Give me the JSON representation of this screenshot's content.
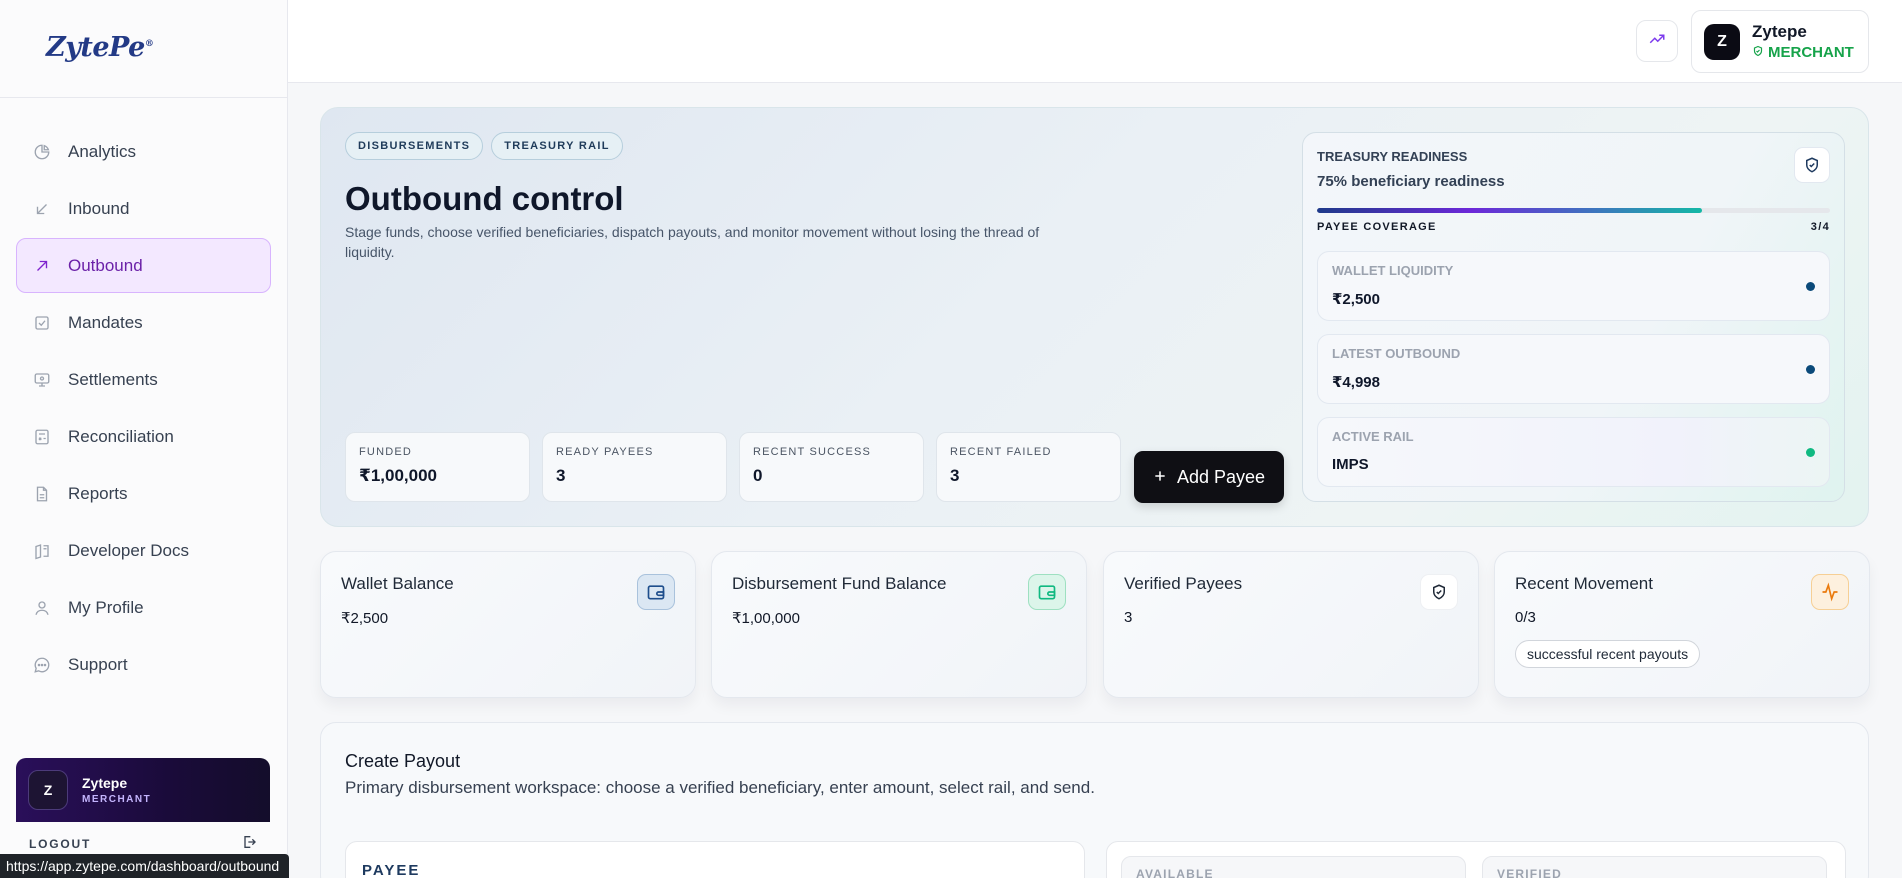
{
  "brand": {
    "logo_text": "ZytePe",
    "logo_mark": "®"
  },
  "sidebar": {
    "items": [
      {
        "label": "Analytics",
        "icon": "pie-chart-icon"
      },
      {
        "label": "Inbound",
        "icon": "arrow-down-left-icon"
      },
      {
        "label": "Outbound",
        "icon": "arrow-up-right-icon",
        "active": true
      },
      {
        "label": "Mandates",
        "icon": "checklist-icon"
      },
      {
        "label": "Settlements",
        "icon": "monitor-icon"
      },
      {
        "label": "Reconciliation",
        "icon": "calculator-icon"
      },
      {
        "label": "Reports",
        "icon": "file-icon"
      },
      {
        "label": "Developer Docs",
        "icon": "book-icon"
      },
      {
        "label": "My Profile",
        "icon": "user-icon"
      },
      {
        "label": "Support",
        "icon": "chat-icon"
      }
    ],
    "user": {
      "initial": "Z",
      "name": "Zytepe",
      "role": "MERCHANT"
    },
    "logout_label": "LOGOUT"
  },
  "status_url": "https://app.zytepe.com/dashboard/outbound",
  "topbar": {
    "account": {
      "initial": "Z",
      "name": "Zytepe",
      "role": "MERCHANT"
    }
  },
  "hero": {
    "tags": [
      "DISBURSEMENTS",
      "TREASURY RAIL"
    ],
    "title": "Outbound control",
    "subtitle": "Stage funds, choose verified beneficiaries, dispatch payouts, and monitor movement without losing the thread of liquidity.",
    "stats": [
      {
        "label": "FUNDED",
        "value": "₹1,00,000"
      },
      {
        "label": "READY PAYEES",
        "value": "3"
      },
      {
        "label": "RECENT SUCCESS",
        "value": "0"
      },
      {
        "label": "RECENT FAILED",
        "value": "3"
      }
    ],
    "add_payee_label": "Add Payee",
    "readiness": {
      "title": "TREASURY READINESS",
      "subtitle": "75% beneficiary readiness",
      "progress": 0.75,
      "coverage_label": "PAYEE COVERAGE",
      "coverage_value": "3/4",
      "cards": [
        {
          "label": "WALLET LIQUIDITY",
          "value": "₹2,500",
          "dot_color": "#0b4a7a"
        },
        {
          "label": "LATEST OUTBOUND",
          "value": "₹4,998",
          "dot_color": "#0b4a7a"
        },
        {
          "label": "ACTIVE RAIL",
          "value": "IMPS",
          "dot_color": "#10b981"
        }
      ]
    }
  },
  "summary": [
    {
      "title": "Wallet Balance",
      "value": "₹2,500",
      "icon": "wallet-icon"
    },
    {
      "title": "Disbursement Fund Balance",
      "value": "₹1,00,000",
      "icon": "wallet-green-icon"
    },
    {
      "title": "Verified Payees",
      "value": "3",
      "icon": "shield-check-icon"
    },
    {
      "title": "Recent Movement",
      "value": "0/3",
      "icon": "activity-icon",
      "pill": "successful recent payouts"
    }
  ],
  "payout": {
    "title": "Create Payout",
    "subtitle": "Primary disbursement workspace: choose a verified beneficiary, enter amount, select rail, and send.",
    "payee_label": "PAYEE",
    "available_label": "AVAILABLE",
    "verified_label": "VERIFIED"
  }
}
